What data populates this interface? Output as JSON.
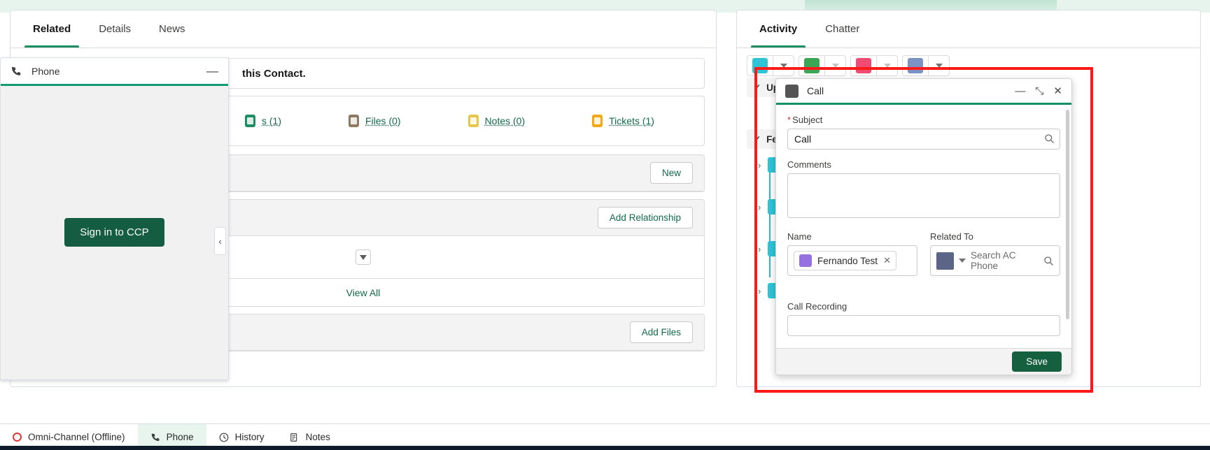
{
  "record": {
    "tabs": [
      {
        "label": "Related",
        "active": true
      },
      {
        "label": "Details",
        "active": false
      },
      {
        "label": "News",
        "active": false
      }
    ],
    "note_text": "this Contact.",
    "quicklinks": [
      {
        "label": "s (1)",
        "color": "#1b8f63"
      },
      {
        "label": "Files (0)",
        "color": "#8c7b60"
      },
      {
        "label": "Notes (0)",
        "color": "#e4c74a"
      },
      {
        "label": "Tickets (1)",
        "color": "#f0a818"
      }
    ],
    "sections": {
      "new_button": "New",
      "add_relationship_button": "Add Relationship",
      "view_all_link": "View All",
      "add_files_button": "Add Files"
    }
  },
  "softphone": {
    "title": "Phone",
    "minimize_glyph": "—",
    "sign_in_button": "Sign in to CCP",
    "collapse_glyph": "‹"
  },
  "activity": {
    "tabs": [
      {
        "label": "Activity",
        "active": true
      },
      {
        "label": "Chatter",
        "active": false
      }
    ],
    "action_buttons": [
      {
        "name": "log-a-call",
        "color": "#2ec4d6"
      },
      {
        "name": "new-task",
        "color": "#3ba755"
      },
      {
        "name": "new-event",
        "color": "#ef4b75"
      },
      {
        "name": "email",
        "color": "#7b92c4"
      }
    ],
    "groups": [
      {
        "label": "Up",
        "check": "✓"
      },
      {
        "label": "Fe",
        "check": "✓"
      }
    ],
    "timeline_items": [
      {
        "chevron": "›"
      },
      {
        "chevron": "›"
      },
      {
        "chevron": "›"
      },
      {
        "chevron": "›"
      }
    ]
  },
  "call_modal": {
    "title": "Call",
    "minimize_glyph": "—",
    "expand_glyph": "⤡",
    "close_glyph": "✕",
    "subject_label": "Subject",
    "subject_required": "*",
    "subject_value": "Call",
    "comments_label": "Comments",
    "comments_value": "",
    "name_label": "Name",
    "name_pill_value": "Fernando Test",
    "name_pill_remove": "✕",
    "related_to_label": "Related To",
    "related_to_placeholder": "Search AC Phone",
    "call_recording_label": "Call Recording",
    "call_recording_value": "",
    "save_button": "Save"
  },
  "utility_bar": {
    "items": [
      {
        "label": "Omni-Channel (Offline)",
        "icon": "circle-icon",
        "active": false
      },
      {
        "label": "Phone",
        "icon": "phone-icon",
        "active": true
      },
      {
        "label": "History",
        "icon": "clock-icon",
        "active": false
      },
      {
        "label": "Notes",
        "icon": "notes-icon",
        "active": false
      }
    ]
  },
  "colors": {
    "brand_green": "#159b70",
    "link_green": "#136a4a",
    "highlight_red": "#ff1a1a"
  }
}
